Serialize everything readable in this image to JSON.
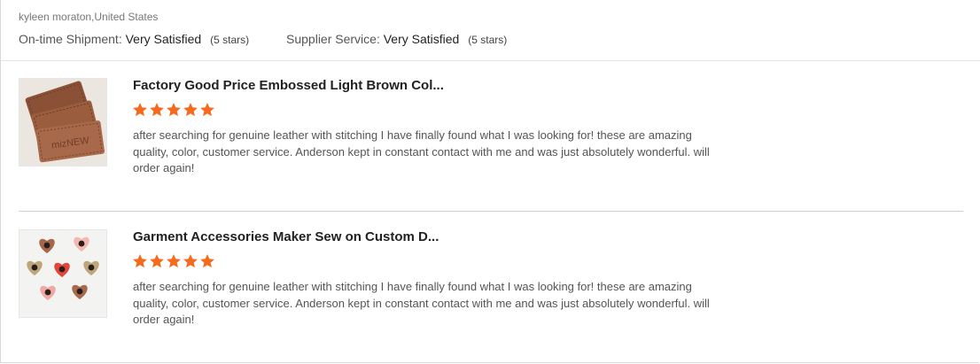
{
  "header": {
    "reviewer": "kyleen moraton,United States",
    "ratings": [
      {
        "label": "On-time Shipment:",
        "value": "Very Satisfied",
        "stars_text": "(5 stars)"
      },
      {
        "label": "Supplier Service:",
        "value": "Very Satisfied",
        "stars_text": "(5 stars)"
      }
    ]
  },
  "reviews": [
    {
      "product_title": "Factory Good Price Embossed Light Brown Col...",
      "rating": 5,
      "thumb_text": "mizNEW",
      "text": "after searching for genuine leather with stitching I have finally found what I was looking for!  these are amazing quality, color, customer service.  Anderson kept in constant contact with me and was just absolutely wonderful.  will order again!"
    },
    {
      "product_title": "Garment Accessories Maker Sew on Custom D...",
      "rating": 5,
      "text": "after searching for genuine leather with stitching I have finally found what I was looking for!  these are amazing quality, color, customer service.  Anderson kept in constant contact with me and was just absolutely wonderful.  will order again!"
    }
  ],
  "colors": {
    "star": "#f56a1c"
  },
  "icons": {
    "star": "star-icon"
  }
}
